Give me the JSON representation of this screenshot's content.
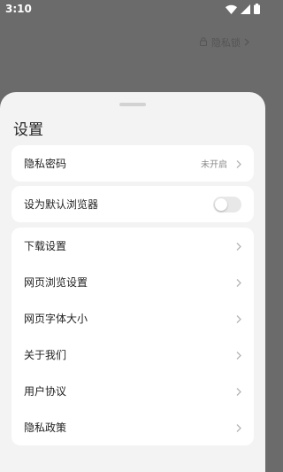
{
  "status_bar": {
    "time": "3:10",
    "icons": [
      "wifi-icon",
      "signal-icon",
      "battery-icon"
    ]
  },
  "background": {
    "link_label": "隐私锁",
    "icon": "lock-icon"
  },
  "sheet": {
    "title": "设置",
    "cards": {
      "privacy": {
        "label": "隐私密码",
        "value": "未开启"
      },
      "default_browser": {
        "label": "设为默认浏览器",
        "toggle_on": false
      },
      "items": [
        {
          "label": "下载设置"
        },
        {
          "label": "网页浏览设置"
        },
        {
          "label": "网页字体大小"
        },
        {
          "label": "关于我们"
        },
        {
          "label": "用户协议"
        },
        {
          "label": "隐私政策"
        }
      ]
    }
  },
  "colors": {
    "overlay": "#6b6b6b",
    "sheet_bg": "#f3f3f3",
    "card_bg": "#ffffff",
    "text_primary": "#222222",
    "text_secondary": "#8a8a8a"
  }
}
